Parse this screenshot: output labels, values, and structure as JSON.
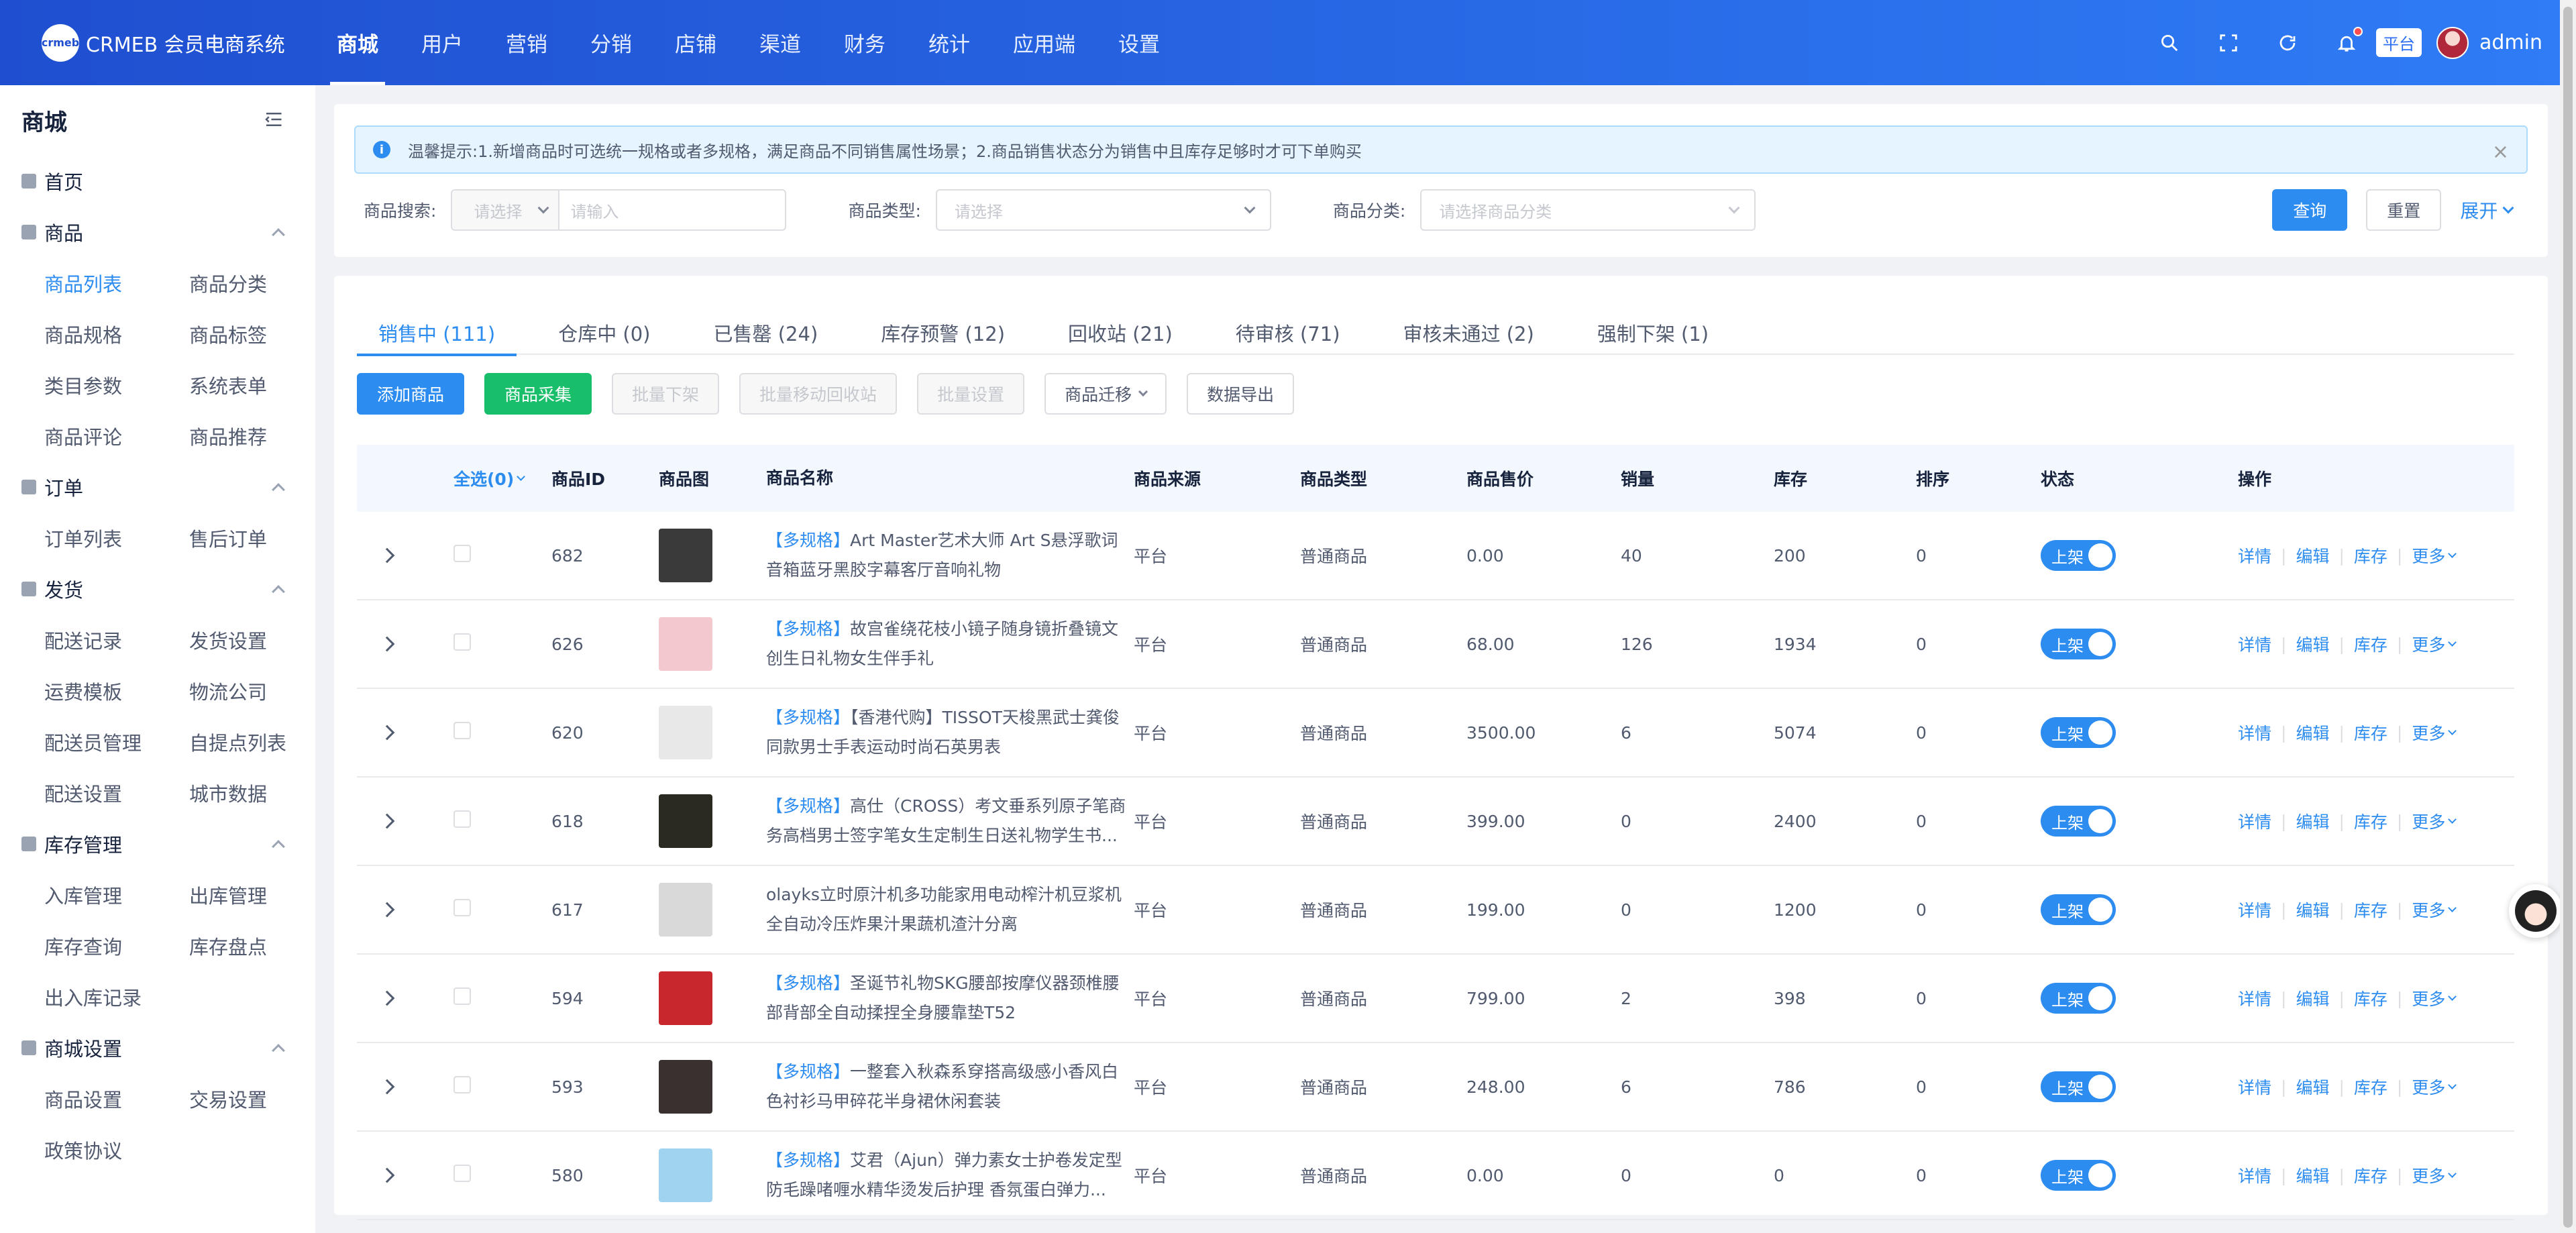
{
  "brand": {
    "logo_text": "crmeb",
    "name": "CRMEB 会员电商系统"
  },
  "nav": [
    {
      "label": "商城",
      "active": true
    },
    {
      "label": "用户"
    },
    {
      "label": "营销"
    },
    {
      "label": "分销"
    },
    {
      "label": "店铺"
    },
    {
      "label": "渠道"
    },
    {
      "label": "财务"
    },
    {
      "label": "统计"
    },
    {
      "label": "应用端"
    },
    {
      "label": "设置"
    }
  ],
  "topbar": {
    "tenant": "平台",
    "username": "admin"
  },
  "sidebar": {
    "title": "商城",
    "home": "首页",
    "groups": [
      {
        "label": "商品",
        "items": [
          "商品列表",
          "商品分类",
          "商品规格",
          "商品标签",
          "类目参数",
          "系统表单",
          "商品评论",
          "商品推荐"
        ]
      },
      {
        "label": "订单",
        "items": [
          "订单列表",
          "售后订单"
        ]
      },
      {
        "label": "发货",
        "items": [
          "配送记录",
          "发货设置",
          "运费模板",
          "物流公司",
          "配送员管理",
          "自提点列表",
          "配送设置",
          "城市数据"
        ]
      },
      {
        "label": "库存管理",
        "items": [
          "入库管理",
          "出库管理",
          "库存查询",
          "库存盘点",
          "出入库记录"
        ]
      },
      {
        "label": "商城设置",
        "items": [
          "商品设置",
          "交易设置",
          "政策协议"
        ]
      }
    ]
  },
  "notice": {
    "text": "温馨提示:1.新增商品时可选统一规格或者多规格，满足商品不同销售属性场景；2.商品销售状态分为销售中且库存足够时才可下单购买"
  },
  "filters": {
    "search_label": "商品搜索:",
    "search_select_placeholder": "请选择",
    "search_input_placeholder": "请输入",
    "type_label": "商品类型:",
    "type_placeholder": "请选择",
    "category_label": "商品分类:",
    "category_placeholder": "请选择商品分类",
    "query": "查询",
    "reset": "重置",
    "expand": "展开"
  },
  "tabs": [
    {
      "label": "销售中 (111)",
      "active": true
    },
    {
      "label": "仓库中 (0)"
    },
    {
      "label": "已售罄 (24)"
    },
    {
      "label": "库存预警 (12)"
    },
    {
      "label": "回收站 (21)"
    },
    {
      "label": "待审核 (71)"
    },
    {
      "label": "审核未通过 (2)"
    },
    {
      "label": "强制下架 (1)"
    }
  ],
  "actions": {
    "add": "添加商品",
    "collect": "商品采集",
    "batch_off": "批量下架",
    "batch_recycle": "批量移动回收站",
    "batch_setting": "批量设置",
    "migrate": "商品迁移",
    "export": "数据导出"
  },
  "table": {
    "headers": {
      "select_all": "全选(0)",
      "id": "商品ID",
      "image": "商品图",
      "name": "商品名称",
      "source": "商品来源",
      "type": "商品类型",
      "price": "商品售价",
      "sales": "销量",
      "stock": "库存",
      "sort": "排序",
      "status": "状态",
      "ops": "操作"
    },
    "rows": [
      {
        "id": "682",
        "tag": "【多规格】",
        "name": "Art Master艺术大师 Art S悬浮歌词音箱蓝牙黑胶字幕客厅音响礼物",
        "source": "平台",
        "type": "普通商品",
        "price": "0.00",
        "sales": "40",
        "stock": "200",
        "sort": "0",
        "status": "上架",
        "thumb": "#3a3a3a"
      },
      {
        "id": "626",
        "tag": "【多规格】",
        "name": "故宫雀绕花枝小镜子随身镜折叠镜文创生日礼物女生伴手礼",
        "source": "平台",
        "type": "普通商品",
        "price": "68.00",
        "sales": "126",
        "stock": "1934",
        "sort": "0",
        "status": "上架",
        "thumb": "#f3c9cf"
      },
      {
        "id": "620",
        "tag": "【多规格】",
        "name": "【香港代购】TISSOT天梭黑武士龚俊同款男士手表运动时尚石英男表",
        "source": "平台",
        "type": "普通商品",
        "price": "3500.00",
        "sales": "6",
        "stock": "5074",
        "sort": "0",
        "status": "上架",
        "thumb": "#e8e8e8"
      },
      {
        "id": "618",
        "tag": "【多规格】",
        "name": "高仕（CROSS）考文垂系列原子笔商务高档男士签字笔女生定制生日送礼物学生书...",
        "source": "平台",
        "type": "普通商品",
        "price": "399.00",
        "sales": "0",
        "stock": "2400",
        "sort": "0",
        "status": "上架",
        "thumb": "#2a2a20"
      },
      {
        "id": "617",
        "tag": "",
        "name": "olayks立时原汁机多功能家用电动榨汁机豆浆机全自动冷压炸果汁果蔬机渣汁分离",
        "source": "平台",
        "type": "普通商品",
        "price": "199.00",
        "sales": "0",
        "stock": "1200",
        "sort": "0",
        "status": "上架",
        "thumb": "#d9d9d9"
      },
      {
        "id": "594",
        "tag": "【多规格】",
        "name": "圣诞节礼物SKG腰部按摩仪器颈椎腰部背部全自动揉捏全身腰靠垫T52",
        "source": "平台",
        "type": "普通商品",
        "price": "799.00",
        "sales": "2",
        "stock": "398",
        "sort": "0",
        "status": "上架",
        "thumb": "#c8272e"
      },
      {
        "id": "593",
        "tag": "【多规格】",
        "name": "一整套入秋森系穿搭高级感小香风白色衬衫马甲碎花半身裙休闲套装",
        "source": "平台",
        "type": "普通商品",
        "price": "248.00",
        "sales": "6",
        "stock": "786",
        "sort": "0",
        "status": "上架",
        "thumb": "#3b3030"
      },
      {
        "id": "580",
        "tag": "【多规格】",
        "name": "艾君（Ajun）弹力素女士护卷发定型防毛躁啫喱水精华烫发后护理 香氛蛋白弹力...",
        "source": "平台",
        "type": "普通商品",
        "price": "0.00",
        "sales": "0",
        "stock": "0",
        "sort": "0",
        "status": "上架",
        "thumb": "#9fd3ef"
      }
    ],
    "ops": {
      "detail": "详情",
      "edit": "编辑",
      "stock": "库存",
      "more": "更多"
    }
  }
}
